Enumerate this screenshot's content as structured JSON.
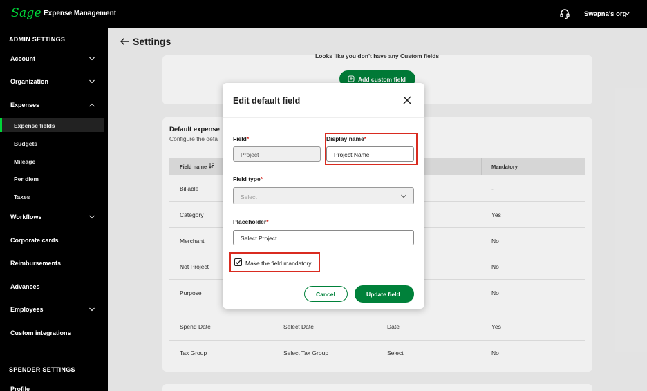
{
  "topbar": {
    "logo": "Sage",
    "app_title": "Expense Management",
    "org_name": "Swapna's org"
  },
  "sidebar": {
    "admin_section": "ADMIN SETTINGS",
    "spender_section": "SPENDER SETTINGS",
    "items": [
      {
        "label": "Account"
      },
      {
        "label": "Organization"
      },
      {
        "label": "Expenses"
      },
      {
        "label": "Expense fields"
      },
      {
        "label": "Budgets"
      },
      {
        "label": "Mileage"
      },
      {
        "label": "Per diem"
      },
      {
        "label": "Taxes"
      },
      {
        "label": "Workflows"
      },
      {
        "label": "Corporate cards"
      },
      {
        "label": "Reimbursements"
      },
      {
        "label": "Advances"
      },
      {
        "label": "Employees"
      },
      {
        "label": "Custom integrations"
      },
      {
        "label": "Profile"
      }
    ]
  },
  "header": {
    "title": "Settings"
  },
  "custom_fields": {
    "empty_text": "Looks like you don't have any Custom fields",
    "add_button": "Add custom field"
  },
  "default_fields": {
    "title": "Default expense",
    "subtitle": "Configure the defa",
    "columns": [
      "Field name",
      "Mandatory"
    ],
    "rows": [
      {
        "name": "Billable",
        "placeholder": "",
        "type": "",
        "mandatory": "-"
      },
      {
        "name": "Category",
        "placeholder": "",
        "type": "",
        "mandatory": "Yes"
      },
      {
        "name": "Merchant",
        "placeholder": "",
        "type": "",
        "mandatory": "No"
      },
      {
        "name": "Not Project",
        "placeholder": "",
        "type": "",
        "mandatory": "No"
      },
      {
        "name": "Purpose",
        "placeholder": "",
        "type": "",
        "mandatory": "No"
      },
      {
        "name": "Spend Date",
        "placeholder": "Select Date",
        "type": "Date",
        "mandatory": "Yes"
      },
      {
        "name": "Tax Group",
        "placeholder": "Select Tax Group",
        "type": "Select",
        "mandatory": "No"
      }
    ]
  },
  "modal": {
    "title": "Edit default field",
    "field_label": "Field",
    "field_value": "Project",
    "display_name_label": "Display name",
    "display_name_value": "Project Name",
    "field_type_label": "Field type",
    "field_type_placeholder": "Select",
    "placeholder_label": "Placeholder",
    "placeholder_value": "Select Project",
    "mandatory_label": "Make the field mandatory",
    "mandatory_checked": true,
    "cancel_label": "Cancel",
    "update_label": "Update field",
    "required_mark": "*"
  },
  "colors": {
    "brand_green": "#00d639",
    "button_green": "#00813a",
    "highlight_red": "#d92b20"
  }
}
